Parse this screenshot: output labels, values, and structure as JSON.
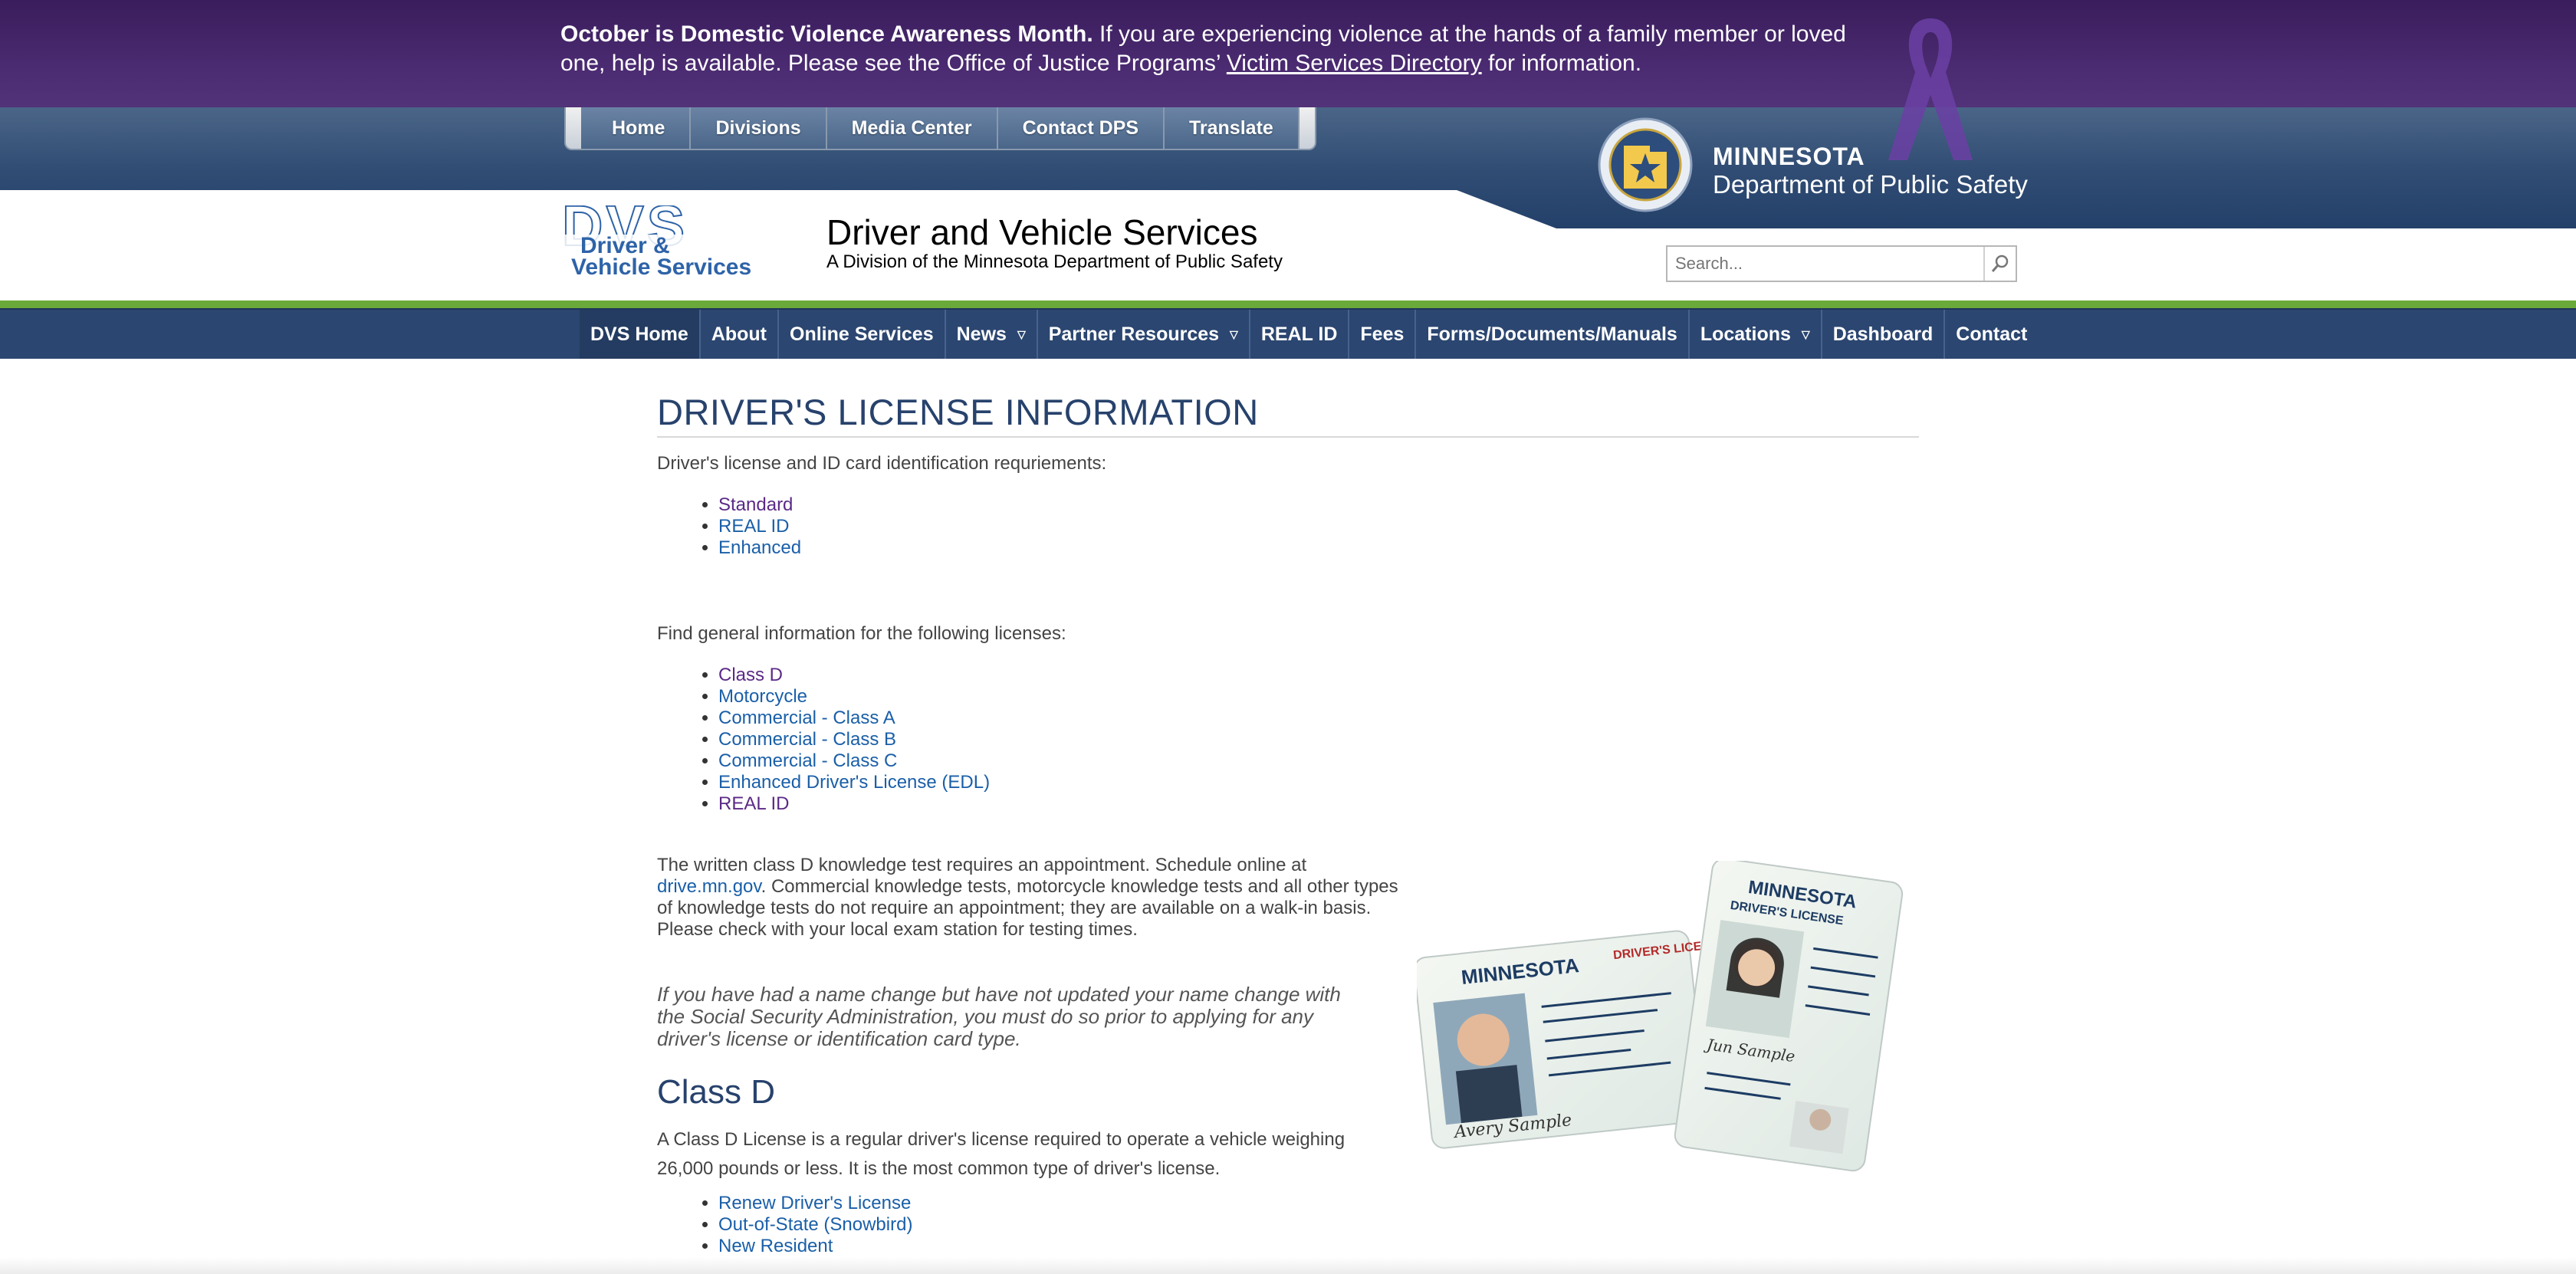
{
  "banner": {
    "bold": "October is Domestic Violence Awareness Month.",
    "text": " If you are experiencing violence at the hands of a family member or loved one, help is available. Please see the Office of Justice Programs’ ",
    "link": "Victim Services Directory",
    "tail": " for information."
  },
  "top_nav": [
    "Home",
    "Divisions",
    "Media Center",
    "Contact DPS",
    "Translate"
  ],
  "dps": {
    "state": "MINNESOTA",
    "dept": "Department of Public Safety"
  },
  "site": {
    "logo_line1": "Driver &",
    "logo_line2": "Vehicle Services",
    "title": "Driver and Vehicle Services",
    "subtitle": "A Division of the Minnesota Department of Public Safety"
  },
  "search": {
    "placeholder": "Search..."
  },
  "main_nav": [
    {
      "label": "DVS Home",
      "dropdown": false
    },
    {
      "label": "About",
      "dropdown": false
    },
    {
      "label": "Online Services",
      "dropdown": false
    },
    {
      "label": "News",
      "dropdown": true
    },
    {
      "label": "Partner Resources",
      "dropdown": true
    },
    {
      "label": "REAL ID",
      "dropdown": false
    },
    {
      "label": "Fees",
      "dropdown": false
    },
    {
      "label": "Forms/Documents/Manuals",
      "dropdown": false
    },
    {
      "label": "Locations",
      "dropdown": true
    },
    {
      "label": "Dashboard",
      "dropdown": false
    },
    {
      "label": "Contact",
      "dropdown": false
    }
  ],
  "main": {
    "title": "DRIVER'S LICENSE INFORMATION",
    "intro1": "Driver's license and ID card identification requriements:",
    "id_types": [
      "Standard",
      "REAL ID",
      "Enhanced"
    ],
    "intro2": "Find general information for the following licenses:",
    "license_types": [
      "Class D",
      "Motorcycle",
      "Commercial - Class A",
      "Commercial - Class B",
      "Commercial - Class C",
      "Enhanced Driver's License (EDL)",
      "REAL ID"
    ],
    "test_text_1": "The written class D knowledge test requires an appointment. Schedule online at",
    "test_link": "drive.mn.gov",
    "test_text_2": ". Commercial knowledge tests, motorcycle knowledge tests and all other types of knowledge tests do not require an appointment; they are available on a walk-in basis. Please check with your local exam station for testing times.",
    "name_change": "If you have had a name change but have not updated your name change with the Social Security Administration, you must do so prior to applying for any driver's license or identification card type.",
    "class_d_heading": "Class D",
    "class_d_text": "A Class D License is a regular driver's license required to operate a vehicle weighing 26,000 pounds or less. It is the most common type of driver's license.",
    "class_d_links": [
      "Renew Driver's License",
      "Out-of-State (Snowbird)",
      "New Resident"
    ]
  },
  "cards": {
    "card1_state": "MINNESOTA",
    "card1_type": "DRIVER'S LICENSE",
    "card2_state": "MINNESOTA",
    "card2_type": "DRIVER'S LICENSE",
    "sig1": "Avery Sample",
    "sig2": "Jun Sample"
  },
  "colors": {
    "banner": "#4a2a70",
    "header_blue": "#2b4670",
    "green_rule": "#6aaa3a",
    "link": "#1a5fa8",
    "visited_link": "#5b2a86",
    "heading": "#27426c"
  }
}
